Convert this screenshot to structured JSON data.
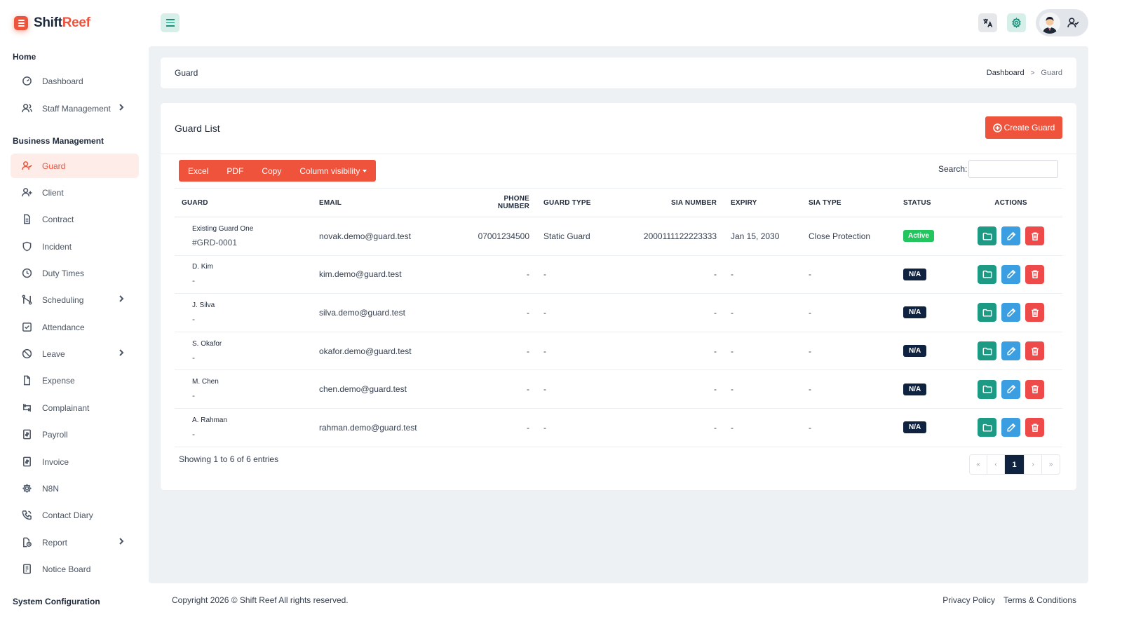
{
  "brand": {
    "name_part1": "Shift",
    "name_part2": "Reef"
  },
  "sidebar": {
    "sections": {
      "home": "Home",
      "business": "Business Management",
      "system": "System Configuration"
    },
    "items": [
      {
        "label": "Dashboard",
        "icon": "dashboard-icon"
      },
      {
        "label": "Staff Management",
        "icon": "users-icon",
        "has_submenu": true
      },
      {
        "label": "Guard",
        "icon": "user-check-icon",
        "active": true
      },
      {
        "label": "Client",
        "icon": "user-plus-icon"
      },
      {
        "label": "Contract",
        "icon": "document-icon"
      },
      {
        "label": "Incident",
        "icon": "shield-icon"
      },
      {
        "label": "Duty Times",
        "icon": "clock-icon"
      },
      {
        "label": "Scheduling",
        "icon": "route-icon",
        "has_submenu": true
      },
      {
        "label": "Attendance",
        "icon": "checkbox-icon"
      },
      {
        "label": "Leave",
        "icon": "ban-icon",
        "has_submenu": true
      },
      {
        "label": "Expense",
        "icon": "file-icon"
      },
      {
        "label": "Complainant",
        "icon": "swap-icon"
      },
      {
        "label": "Payroll",
        "icon": "receipt-icon"
      },
      {
        "label": "Invoice",
        "icon": "invoice-icon"
      },
      {
        "label": "N8N",
        "icon": "cog-icon"
      },
      {
        "label": "Contact Diary",
        "icon": "phone-icon"
      },
      {
        "label": "Report",
        "icon": "report-icon",
        "has_submenu": true
      },
      {
        "label": "Notice Board",
        "icon": "notice-icon"
      }
    ]
  },
  "header": {
    "translate_icon": "translate-icon",
    "settings_icon": "gear-icon",
    "user_icon": "user-check-icon"
  },
  "breadcrumb": {
    "title": "Guard",
    "trail": [
      "Dashboard",
      "Guard"
    ]
  },
  "guard_list": {
    "title": "Guard List",
    "create_button": "Create Guard",
    "export_buttons": [
      "Excel",
      "PDF",
      "Copy",
      "Column visibility"
    ],
    "search_label": "Search:",
    "search_value": "",
    "columns": [
      "GUARD",
      "EMAIL",
      "PHONE NUMBER",
      "GUARD TYPE",
      "SIA NUMBER",
      "EXPIRY",
      "SIA TYPE",
      "STATUS",
      "ACTIONS"
    ],
    "rows": [
      {
        "name": "Existing Guard One",
        "code": "#GRD-0001",
        "email": "novak.demo@guard.test",
        "phone": "07001234500",
        "guard_type": "Static Guard",
        "sia_number": "2000111122223333",
        "expiry": "Jan 15, 2030",
        "sia_type": "Close Protection",
        "status": "Active"
      },
      {
        "name": "D. Kim",
        "code": "-",
        "email": "kim.demo@guard.test",
        "phone": "-",
        "guard_type": "-",
        "sia_number": "-",
        "expiry": "-",
        "sia_type": "-",
        "status": "N/A"
      },
      {
        "name": "J. Silva",
        "code": "-",
        "email": "silva.demo@guard.test",
        "phone": "-",
        "guard_type": "-",
        "sia_number": "-",
        "expiry": "-",
        "sia_type": "-",
        "status": "N/A"
      },
      {
        "name": "S. Okafor",
        "code": "-",
        "email": "okafor.demo@guard.test",
        "phone": "-",
        "guard_type": "-",
        "sia_number": "-",
        "expiry": "-",
        "sia_type": "-",
        "status": "N/A"
      },
      {
        "name": "M. Chen",
        "code": "-",
        "email": "chen.demo@guard.test",
        "phone": "-",
        "guard_type": "-",
        "sia_number": "-",
        "expiry": "-",
        "sia_type": "-",
        "status": "N/A"
      },
      {
        "name": "A. Rahman",
        "code": "-",
        "email": "rahman.demo@guard.test",
        "phone": "-",
        "guard_type": "-",
        "sia_number": "-",
        "expiry": "-",
        "sia_type": "-",
        "status": "N/A"
      }
    ],
    "entries_info": "Showing 1 to 6 of 6 entries",
    "pagination": {
      "first": "«",
      "prev": "‹",
      "current": "1",
      "next": "›",
      "last": "»"
    }
  },
  "footer": {
    "copyright": "Copyright 2026 © Shift Reef All rights reserved.",
    "links": [
      "Privacy Policy",
      "Terms & Conditions"
    ]
  },
  "colors": {
    "accent": "#f0533c",
    "teal": "#1c9a83",
    "blue": "#3b9ee0",
    "red": "#ef4a4a",
    "navy": "#0f2240",
    "green": "#22c55e"
  }
}
